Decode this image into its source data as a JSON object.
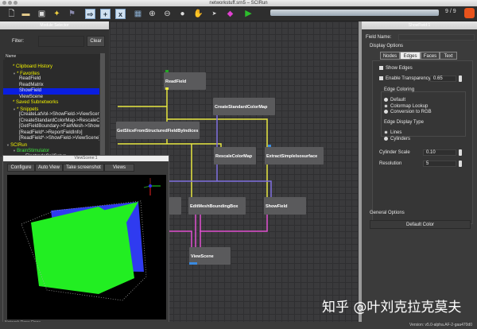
{
  "window": {
    "title": "networkstuff.srn5 – SCIRun"
  },
  "toolbar": {
    "progress_text": "9 / 9",
    "progress_fraction": 1.0,
    "icons": [
      "new-file-icon",
      "open-folder-icon",
      "save-icon",
      "wizard-icon",
      "dependency-icon",
      "execute-icon",
      "add-icon",
      "close-x-icon",
      "layout-icon",
      "zoom-in-icon",
      "zoom-out-icon",
      "zoom-reset-icon",
      "hand-icon",
      "pointer-icon",
      "module-cube-icon",
      "run-icon",
      "alarm-icon"
    ]
  },
  "module_selector": {
    "title": "Module Selector",
    "filter_label": "Filter:",
    "filter_value": "",
    "clear_label": "Clear",
    "column_header": "Name",
    "items": [
      {
        "label": "* Clipboard History",
        "color": "y",
        "indent": 1
      },
      {
        "label": "* Favorites",
        "color": "y",
        "indent": 1,
        "arrow": "▼"
      },
      {
        "label": "ReadField",
        "color": "w",
        "indent": 2
      },
      {
        "label": "ReadMatrix",
        "color": "w",
        "indent": 2
      },
      {
        "label": "ShowField",
        "color": "w",
        "indent": 2,
        "selected": true
      },
      {
        "label": "ViewScene",
        "color": "w",
        "indent": 2
      },
      {
        "label": "* Saved Subnetworks",
        "color": "y",
        "indent": 1
      },
      {
        "label": "* Snippets",
        "color": "y",
        "indent": 1,
        "arrow": "▼"
      },
      {
        "label": "[CreateLatVol->ShowField->ViewScene]",
        "color": "w",
        "indent": 2
      },
      {
        "label": "[CreateStandardColorMap->RescaleColorMap]",
        "color": "w",
        "indent": 2
      },
      {
        "label": "[GetFieldBoundary->FairMesh->ShowField]",
        "color": "w",
        "indent": 2
      },
      {
        "label": "[ReadField*->ReportFieldInfo]",
        "color": "w",
        "indent": 2
      },
      {
        "label": "[ReadField*->ShowField->ViewScene]",
        "color": "w",
        "indent": 2
      },
      {
        "label": "SCIRun",
        "color": "y",
        "indent": 0,
        "arrow": "▼"
      },
      {
        "label": "BrainStimulator",
        "color": "g",
        "indent": 1,
        "arrow": "▼"
      },
      {
        "label": "ElectrodeCoilSetup",
        "color": "w",
        "indent": 3
      }
    ]
  },
  "network": {
    "modules": [
      {
        "name": "ReadField"
      },
      {
        "name": "CreateStandardColorMap"
      },
      {
        "name": "GetSliceFromStructuredFieldByIndices"
      },
      {
        "name": "RescaleColorMap"
      },
      {
        "name": "ExtractSimpleIsosurface"
      },
      {
        "name": "EditMeshBoundingBox"
      },
      {
        "name": "ShowField"
      },
      {
        "name": "ViewScene"
      }
    ],
    "wire_colors": {
      "field": "#e6e640",
      "colormap": "#8070e0",
      "geometry": "#e050d0"
    }
  },
  "viewscene": {
    "title": "ViewScene:1",
    "buttons": [
      "Configure",
      "Auto View",
      "Take screenshot",
      "Views"
    ],
    "status": "Network Done Done"
  },
  "showfield": {
    "title": "ShowField:1",
    "field_name_label": "Field Name:",
    "display_options": "Display Options",
    "tabs": [
      "Nodes",
      "Edges",
      "Faces",
      "Text"
    ],
    "active_tab": "Edges",
    "show_edges": "Show Edges",
    "enable_transparency": "Enable Transparency",
    "transparency_value": "0.65",
    "edge_coloring": "Edge Coloring",
    "coloring_options": [
      "Default",
      "Colormap Lookup",
      "Conversion to RGB"
    ],
    "coloring_selected": "Colormap Lookup",
    "edge_display_type": "Edge Display Type",
    "display_type_options": [
      "Lines",
      "Cylinders"
    ],
    "display_type_selected": "Lines",
    "cylinder_scale_label": "Cylinder Scale",
    "cylinder_scale_value": "0.10",
    "resolution_label": "Resolution",
    "resolution_value": "5",
    "general_options": "General Options",
    "default_color": "Default Color"
  },
  "status": {
    "version": "Version: v5.0-alpha.AF-2-gaa470d0"
  },
  "watermark": "知乎 @叶刘克拉克莫夫"
}
